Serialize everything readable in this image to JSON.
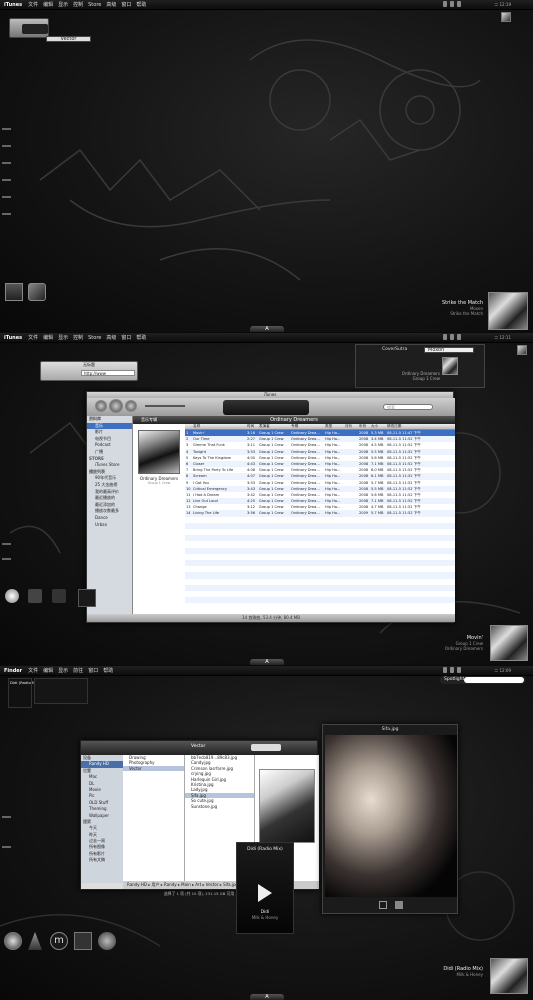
{
  "panel1": {
    "menubar": {
      "app": "iTunes",
      "items": [
        "文件",
        "编辑",
        "显示",
        "控制",
        "Store",
        "高级",
        "窗口",
        "帮助"
      ],
      "clock": "二 12:19"
    },
    "mini_search": "Vector",
    "now_playing": {
      "title": "Strike the Match",
      "artist": "Moxon",
      "album": "Strike the Match"
    },
    "dock_label": "A"
  },
  "panel2": {
    "menubar": {
      "app": "iTunes",
      "items": [
        "文件",
        "编辑",
        "显示",
        "控制",
        "Store",
        "高级",
        "窗口",
        "帮助"
      ],
      "clock": "二 12:11"
    },
    "coversutra": {
      "name": "CoverSutra",
      "search": "Moxon",
      "track": "Ordinary Dreamers",
      "artist": "Group 1 Crew"
    },
    "spotlight_small": {
      "title": "无标题",
      "value": "http://www"
    },
    "itunes": {
      "title": "iTunes",
      "search_placeholder": "搜索",
      "header_left": "音乐专辑",
      "header_title": "Ordinary Dreamers",
      "album_title": "Ordinary Dreamers",
      "album_artist": "Group 1 Crew",
      "sidebar": [
        {
          "label": "资料库",
          "head": true
        },
        {
          "label": "音乐",
          "sel": true
        },
        {
          "label": "影片"
        },
        {
          "label": "电视节目"
        },
        {
          "label": "Podcast"
        },
        {
          "label": "广播"
        },
        {
          "label": "STORE",
          "head": true
        },
        {
          "label": "iTunes Store"
        },
        {
          "label": "播放列表",
          "head": true
        },
        {
          "label": "90年代音乐"
        },
        {
          "label": "25 大金曲榜"
        },
        {
          "label": "我的最高评价"
        },
        {
          "label": "最近播放的"
        },
        {
          "label": "最近添加的"
        },
        {
          "label": "播放次数最多"
        },
        {
          "label": "Dance"
        },
        {
          "label": "Urban"
        }
      ],
      "columns": [
        "",
        "名称",
        "时间",
        "表演者",
        "专辑",
        "类型",
        "评价",
        "年份",
        "大小",
        "修改日期"
      ],
      "rows": [
        [
          "1",
          "Movin'",
          "3:16",
          "Group 1 Crew",
          "Ordinary Drea...",
          "Hip Ho...",
          "",
          "2008",
          "5.3 MB",
          "08-11-5 11:47 下午"
        ],
        [
          "2",
          "Our Time",
          "2:27",
          "Group 1 Crew",
          "Ordinary Drea...",
          "Hip Ho...",
          "",
          "2008",
          "3.4 MB",
          "08-11-5 11:52 下午"
        ],
        [
          "3",
          "Gimme That Funk",
          "3:11",
          "Group 1 Crew",
          "Ordinary Drea...",
          "Hip Ho...",
          "",
          "2008",
          "4.5 MB",
          "08-11-5 11:52 下午"
        ],
        [
          "4",
          "Tonight",
          "3:53",
          "Group 1 Crew",
          "Ordinary Drea...",
          "Hip Ho...",
          "",
          "2008",
          "5.5 MB",
          "08-11-5 11:52 下午"
        ],
        [
          "5",
          "Keys To The Kingdom",
          "4:00",
          "Group 1 Crew",
          "Ordinary Drea...",
          "Hip Ho...",
          "",
          "2008",
          "5.6 MB",
          "08-11-5 11:52 下午"
        ],
        [
          "6",
          "Closer",
          "4:43",
          "Group 1 Crew",
          "Ordinary Drea...",
          "Hip Ho...",
          "",
          "2008",
          "7.1 MB",
          "08-11-5 11:52 下午"
        ],
        [
          "7",
          "Bring The Party To Life",
          "4:08",
          "Group 1 Crew",
          "Ordinary Drea...",
          "Hip Ho...",
          "",
          "2008",
          "6.0 MB",
          "08-11-5 11:52 下午"
        ],
        [
          "8",
          "Scream",
          "4:07",
          "Group 1 Crew",
          "Ordinary Drea...",
          "Hip Ho...",
          "",
          "2008",
          "6.1 MB",
          "08-11-5 11:52 下午"
        ],
        [
          "9",
          "I Got You",
          "3:53",
          "Group 1 Crew",
          "Ordinary Drea...",
          "Hip Ho...",
          "",
          "2008",
          "5.7 MB",
          "08-11-5 11:52 下午"
        ],
        [
          "10",
          "Critical Emergency",
          "3:43",
          "Group 1 Crew",
          "Ordinary Drea...",
          "Hip Ho...",
          "",
          "2008",
          "5.5 MB",
          "08-11-5 11:52 下午"
        ],
        [
          "11",
          "I Had A Dream",
          "3:42",
          "Group 1 Crew",
          "Ordinary Drea...",
          "Hip Ho...",
          "",
          "2008",
          "5.6 MB",
          "08-11-5 11:52 下午"
        ],
        [
          "12",
          "Live Out Loud",
          "4:25",
          "Group 1 Crew",
          "Ordinary Drea...",
          "Hip Ho...",
          "",
          "2008",
          "7.1 MB",
          "08-11-5 11:52 下午"
        ],
        [
          "13",
          "Change",
          "3:12",
          "Group 1 Crew",
          "Ordinary Drea...",
          "Hip Ho...",
          "",
          "2008",
          "4.7 MB",
          "08-11-5 11:52 下午"
        ],
        [
          "14",
          "Living The Life",
          "3:56",
          "Group 1 Crew",
          "Ordinary Drea...",
          "Hip Ho...",
          "",
          "2009",
          "5.7 MB",
          "08-11-5 11:52 下午"
        ]
      ],
      "status": "14 首歌曲, 53.4 分钟, 80.4 MB"
    },
    "now_playing": {
      "title": "Movin'",
      "artist": "Group 1 Crew",
      "album": "Ordinary Dreamers"
    },
    "dock_label": "A"
  },
  "panel3": {
    "menubar": {
      "app": "Finder",
      "items": [
        "文件",
        "编辑",
        "显示",
        "前往",
        "窗口",
        "帮助"
      ],
      "clock": "二 12:09"
    },
    "spotlight": {
      "label": "Spotlight"
    },
    "mini_player": {
      "title": "Didi (Radio Mix)",
      "artist": "Milk & Honey"
    },
    "finder": {
      "title": "Vector",
      "sidebar": [
        {
          "label": "设备",
          "head": true
        },
        {
          "label": "Randy HD",
          "sel": true
        },
        {
          "label": "位置",
          "head": true
        },
        {
          "label": "Mac"
        },
        {
          "label": "DL"
        },
        {
          "label": "Movie"
        },
        {
          "label": "Pic"
        },
        {
          "label": "OLD Stuff"
        },
        {
          "label": "Theming"
        },
        {
          "label": "Wallpaper"
        },
        {
          "label": "搜索",
          "head": true
        },
        {
          "label": "今天"
        },
        {
          "label": "昨天"
        },
        {
          "label": "过去一周"
        },
        {
          "label": "所有图像"
        },
        {
          "label": "所有影片"
        },
        {
          "label": "所有文稿"
        }
      ],
      "col1": [
        "Drawing",
        "Photography",
        "Vector"
      ],
      "col2": [
        "bb7ecb819...89c83.jpg",
        "Candy.jpg",
        "Crimson lasrforre.jpg",
        "crying.jpg",
        "Harlequin Girl.jpg",
        "Kristina.jpg",
        "Lady.jpg",
        "Sifa.jpg",
        "So cute.jpg",
        "Sunstone.jpg"
      ],
      "selected_file": "Sifa.jpg",
      "preview_meta": [
        "名称 Sifa.jpg",
        "种类 JPEG 图像",
        "大小 154 KB",
        "尺寸 1024 × 768"
      ],
      "path": "Randy HD ▸ 用户 ▸ Randy ▸ Main ▸ Art ▸ Vector ▸ Sifa.jpg",
      "status": "选择了 1 项 (共 10 项), 231.15 GB 可用"
    },
    "quicklook": {
      "title": "Sifa.jpg"
    },
    "player": {
      "title": "Didi (Radio Mix)",
      "track": "Didi",
      "artist": "Milk & Honey"
    },
    "now_playing": {
      "title": "Didi (Radio Mix)",
      "artist": "Milk & Honey"
    },
    "dock_label": "A"
  }
}
